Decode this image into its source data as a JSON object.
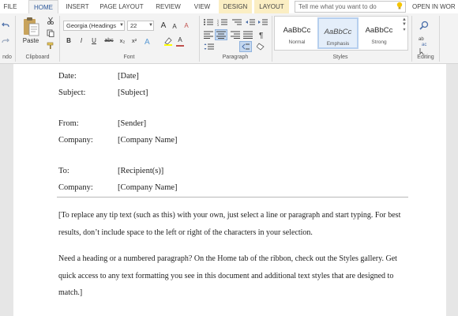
{
  "tabs": [
    "FILE",
    "HOME",
    "INSERT",
    "PAGE LAYOUT",
    "REVIEW",
    "VIEW",
    "DESIGN",
    "LAYOUT"
  ],
  "active_tab": "HOME",
  "tell_me_placeholder": "Tell me what you want to do",
  "open_in": "OPEN IN WOR",
  "ribbon": {
    "undo_label": "ndo",
    "clipboard": {
      "paste_label": "Paste",
      "group_label": "Clipboard"
    },
    "font": {
      "font_name": "Georgia (Headings",
      "font_size": "22",
      "group_label": "Font",
      "bold": "B",
      "italic": "I",
      "underline": "U",
      "strike": "abc",
      "subscript": "x₂",
      "superscript": "x²",
      "grow": "A",
      "shrink": "A",
      "clear": "A",
      "color": "A"
    },
    "paragraph": {
      "group_label": "Paragraph"
    },
    "styles": {
      "group_label": "Styles",
      "items": [
        {
          "sample": "AaBbCc",
          "name": "Normal"
        },
        {
          "sample": "AaBbCc",
          "name": "Emphasis"
        },
        {
          "sample": "AaBbCc",
          "name": "Strong"
        }
      ]
    },
    "editing": {
      "group_label": "Editing"
    }
  },
  "colors": {
    "accent": "#2b579a",
    "design_tab": "#fbeec3"
  },
  "document": {
    "fields": [
      {
        "label": "Date:",
        "value": "[Date]"
      },
      {
        "label": "Subject:",
        "value": "[Subject]"
      },
      {
        "label": "From:",
        "value": "[Sender]"
      },
      {
        "label": "Company:",
        "value": "[Company Name]"
      },
      {
        "label": "To:",
        "value": "[Recipient(s)]"
      },
      {
        "label": "Company:",
        "value": "[Company Name]"
      }
    ],
    "paragraphs": [
      "[To replace any tip text (such as this) with your own, just select a line or paragraph and start typing. For best results, don’t include space to the left or right of the characters in your selection.",
      "Need a heading or a numbered paragraph? On the Home tab of the ribbon, check out the Styles gallery. Get quick access to any text formatting you see in this document and additional text styles that are designed to match.]"
    ]
  }
}
